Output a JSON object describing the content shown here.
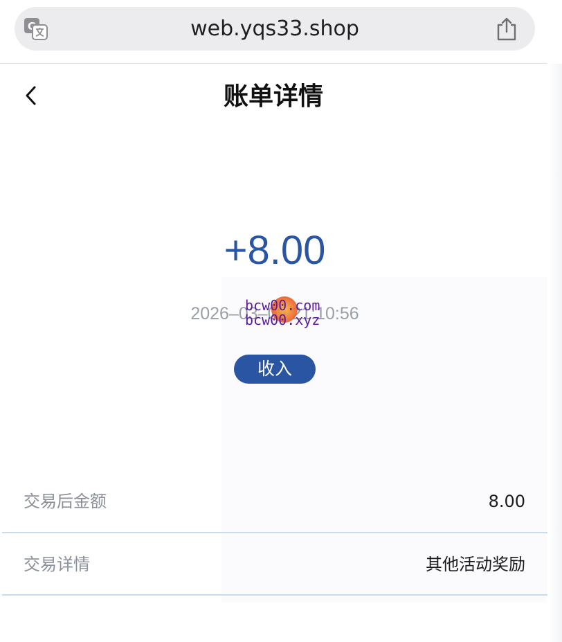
{
  "browser": {
    "url": "web.yqs33.shop",
    "translate_icon": "translate-icon",
    "share_icon": "share-icon"
  },
  "nav": {
    "back_icon": "chevron-left-icon",
    "title": "账单详情"
  },
  "summary": {
    "amount": "+8.00",
    "time": "2026–03–09 21:10:56",
    "type_badge": "收入",
    "amount_color": "#2a55a3"
  },
  "watermark": {
    "line1": "bcw00.com",
    "line2": "bcw00.xyz"
  },
  "details": [
    {
      "label": "交易后金额",
      "value": "8.00"
    },
    {
      "label": "交易详情",
      "value": "其他活动奖励"
    }
  ]
}
